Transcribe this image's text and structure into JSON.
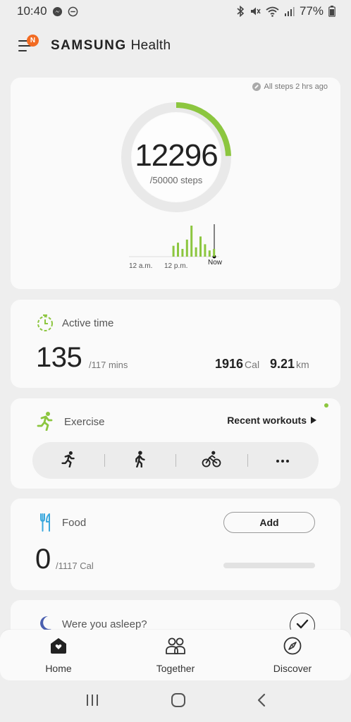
{
  "status_bar": {
    "time": "10:40",
    "battery": "77%",
    "left_icons": [
      "messenger-icon",
      "dnd-icon"
    ],
    "right_icons": [
      "bluetooth-icon",
      "mute-icon",
      "wifi-icon",
      "signal-icon",
      "battery-icon"
    ]
  },
  "header": {
    "badge": "N",
    "brand_strong": "SAMSUNG",
    "brand_light": "Health"
  },
  "steps": {
    "last_sync": "All steps 2 hrs ago",
    "count": "12296",
    "goal": "/50000 steps",
    "progress": 0.246,
    "accent": "#8cc63f",
    "hourly": [
      0,
      0,
      0,
      0,
      0,
      0,
      0,
      0,
      0,
      0.35,
      0.45,
      0.25,
      0.55,
      1.0,
      0.3,
      0.65,
      0.4,
      0.2,
      0.25
    ],
    "labels": {
      "morning": "12 a.m.",
      "noon": "12 p.m.",
      "now": "Now"
    }
  },
  "active": {
    "title": "Active time",
    "minutes": "135",
    "minutes_goal": "/117 mins",
    "calories": "1916",
    "calories_unit": "Cal",
    "distance": "9.21",
    "distance_unit": "km"
  },
  "exercise": {
    "title": "Exercise",
    "recent_label": "Recent workouts",
    "activities": [
      "running-icon",
      "walking-icon",
      "cycling-icon",
      "more-icon"
    ]
  },
  "food": {
    "title": "Food",
    "add_label": "Add",
    "calories": "0",
    "calories_goal": "/1117 Cal"
  },
  "sleep": {
    "question": "Were you asleep?"
  },
  "bottom_nav": {
    "items": [
      {
        "label": "Home",
        "icon": "home-icon"
      },
      {
        "label": "Together",
        "icon": "people-icon"
      },
      {
        "label": "Discover",
        "icon": "compass-icon"
      }
    ]
  },
  "system_nav": [
    "recents-icon",
    "home-circle-icon",
    "back-icon"
  ]
}
